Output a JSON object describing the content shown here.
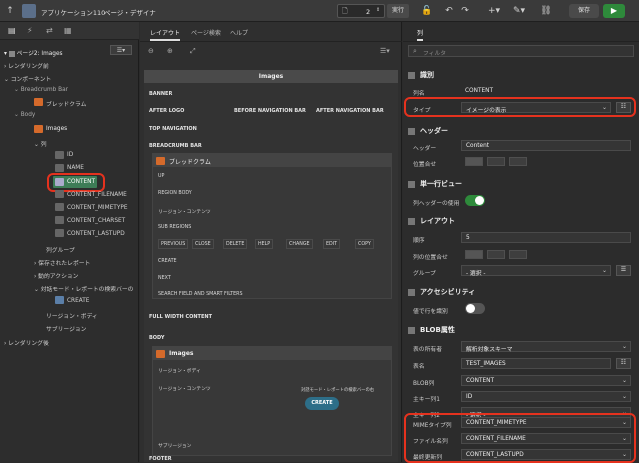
{
  "topbar": {
    "app": "アプリケーション110",
    "page": "ページ・デザイナ",
    "page_number": "2",
    "exec_label": "実行",
    "save_label": "保存"
  },
  "left": {
    "page_title": "ページ2: Images",
    "nodes": {
      "pre_render": "レンダリング前",
      "components": "コンポーネント",
      "breadcrumb_bar": "Breadcrumb Bar",
      "breadcrumb": "ブレッドクラム",
      "body": "Body",
      "images": "Images",
      "columns": "列",
      "id": "ID",
      "name": "NAME",
      "content": "CONTENT",
      "content_filename": "CONTENT_FILENAME",
      "content_mimetype": "CONTENT_MIMETYPE",
      "content_charset": "CONTENT_CHARSET",
      "content_lastupd": "CONTENT_LASTUPD",
      "column_group": "列グループ",
      "saved_reports": "保存されたレポート",
      "actions": "動的アクション",
      "search_bar": "対話モード・レポートの検索バーの",
      "create": "CREATE",
      "region_body": "リージョン・ボディ",
      "sub_region": "サブリージョン",
      "post_render": "レンダリング後"
    }
  },
  "mid": {
    "tabs": [
      "レイアウト",
      "ページ検索",
      "ヘルプ"
    ],
    "header_title": "Images",
    "banner": "BANNER",
    "after_logo": "AFTER LOGO",
    "before_nav": "BEFORE NAVIGATION BAR",
    "after_nav": "AFTER NAVIGATION BAR",
    "top_nav": "TOP NAVIGATION",
    "breadcrumb_bar": "BREADCRUMB BAR",
    "breadcrumb": "ブレッドクラム",
    "up": "UP",
    "region_body": "REGION BODY",
    "region_content": "リージョン・コンテンツ",
    "sub_regions": "SUB REGIONS",
    "buttons": [
      "PREVIOUS",
      "CLOSE",
      "DELETE",
      "HELP",
      "CHANGE",
      "EDIT",
      "COPY"
    ],
    "create": "CREATE",
    "next": "NEXT",
    "search_field": "SEARCH FIELD AND SMART FILTERS",
    "full_width": "FULL WIDTH CONTENT",
    "body": "BODY",
    "images": "Images",
    "body_region": "リージョン・ボディ",
    "body_content": "リージョン・コンテンツ",
    "search_bar": "対話モード・レポートの検索バーの右",
    "create_btn": "CREATE",
    "sub_region": "サブリージョン",
    "footer": "FOOTER"
  },
  "right": {
    "tab": "列",
    "filter_placeholder": "フィルタ",
    "sections": {
      "ident": "識別",
      "header": "ヘッダー",
      "single_row": "単一行ビュー",
      "layout": "レイアウト",
      "a11y": "アクセシビリティ",
      "blob": "BLOB属性"
    },
    "props": {
      "col_name_l": "列名",
      "col_name_v": "CONTENT",
      "type_l": "タイプ",
      "type_v": "イメージの表示",
      "header_l": "ヘッダー",
      "header_v": "Content",
      "align_l": "位置合せ",
      "use_header_l": "列ヘッダーの使用",
      "order_l": "順序",
      "order_v": "5",
      "col_align_l": "列の位置合せ",
      "group_l": "グループ",
      "group_v": "- 選択 -",
      "row_id_l": "値で行を識別",
      "owner_l": "表の所有者",
      "owner_v": "解析対象スキーマ",
      "table_l": "表名",
      "table_v": "TEST_IMAGES",
      "blob_l": "BLOB列",
      "blob_v": "CONTENT",
      "pk1_l": "主キー列1",
      "pk1_v": "ID",
      "pk2_l": "主キー列2",
      "pk2_v": "- 選択 -",
      "mime_l": "MIMEタイプ列",
      "mime_v": "CONTENT_MIMETYPE",
      "fname_l": "ファイル名列",
      "fname_v": "CONTENT_FILENAME",
      "upd_l": "最終更新列",
      "upd_v": "CONTENT_LASTUPD"
    }
  }
}
